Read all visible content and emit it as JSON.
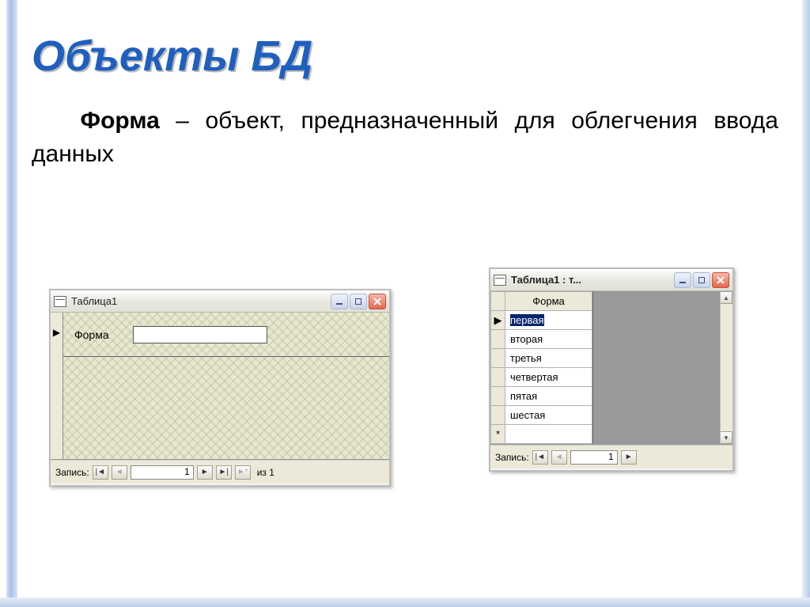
{
  "slide": {
    "title": "Объекты БД",
    "desc_bold": "Форма",
    "desc_rest": " – объект, предназначенный для облегчения ввода данных"
  },
  "form_window": {
    "title": "Таблица1",
    "record_marker": "▶",
    "field_label": "Форма",
    "field_value": "",
    "nav": {
      "label": "Запись:",
      "first": "|◄",
      "prev": "◄",
      "current": "1",
      "next": "►",
      "last": "►|",
      "new": "►*",
      "total": "из 1"
    }
  },
  "table_window": {
    "title": "Таблица1 : т...",
    "column_header": "Форма",
    "rows": [
      {
        "marker": "▶",
        "value": "первая",
        "selected": true
      },
      {
        "marker": "",
        "value": "вторая",
        "selected": false
      },
      {
        "marker": "",
        "value": "третья",
        "selected": false
      },
      {
        "marker": "",
        "value": "четвертая",
        "selected": false
      },
      {
        "marker": "",
        "value": "пятая",
        "selected": false
      },
      {
        "marker": "",
        "value": "шестая",
        "selected": false
      }
    ],
    "new_row_marker": "*",
    "nav": {
      "label": "Запись:",
      "first": "|◄",
      "prev": "◄",
      "current": "1",
      "next": "►"
    }
  },
  "winbuttons": {
    "min": "_",
    "max": "□",
    "close": "X"
  }
}
